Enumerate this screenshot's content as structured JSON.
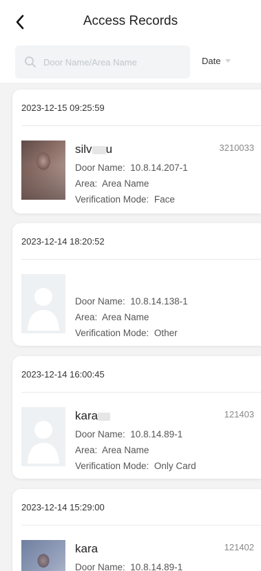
{
  "header": {
    "title": "Access Records"
  },
  "search": {
    "placeholder": "Door Name/Area Name"
  },
  "filter": {
    "date_label": "Date"
  },
  "labels": {
    "door": "Door Name:",
    "area": "Area:",
    "mode": "Verification Mode:"
  },
  "records": [
    {
      "time": "2023-12-15 09:25:59",
      "name_start": "silv",
      "name_end": "u",
      "id": "3210033",
      "door": "10.8.14.207-1",
      "area": "Area Name",
      "mode": "Face"
    },
    {
      "time": "2023-12-14 18:20:52",
      "door": "10.8.14.138-1",
      "area": "Area Name",
      "mode": "Other"
    },
    {
      "time": "2023-12-14 16:00:45",
      "name_start": "kara",
      "id": "121403",
      "door": "10.8.14.89-1",
      "area": "Area Name",
      "mode": "Only Card"
    },
    {
      "time": "2023-12-14 15:29:00",
      "name_start": "kara",
      "id": "121402",
      "door": "10.8.14.89-1"
    }
  ]
}
